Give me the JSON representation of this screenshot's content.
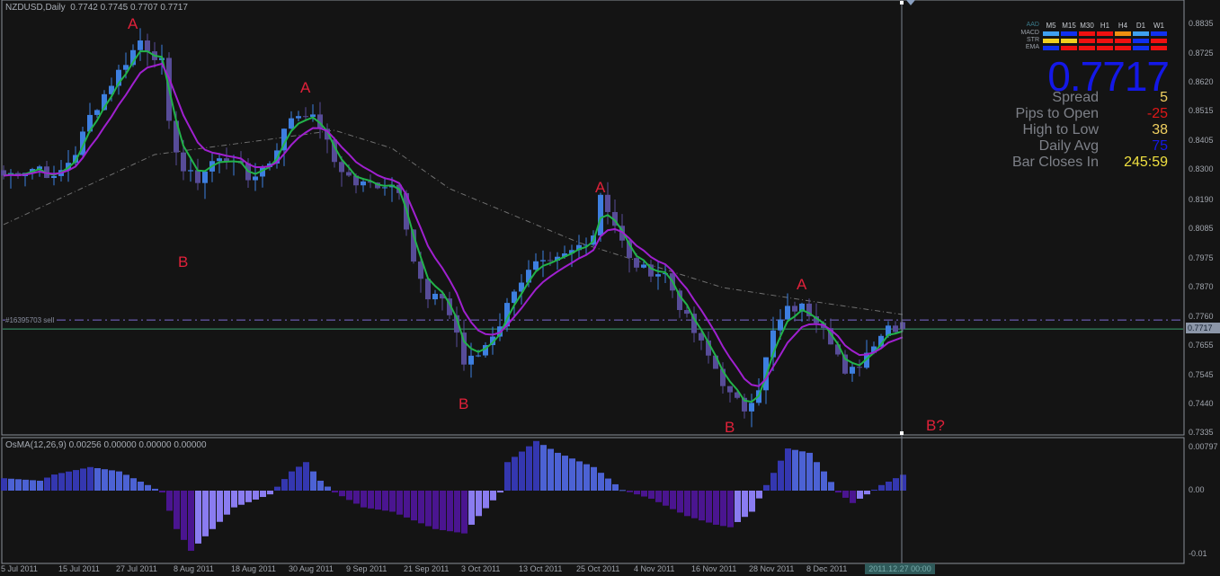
{
  "header": {
    "title": "NZDUSD,Daily",
    "ohlc": "0.7742 0.7745 0.7707 0.7717"
  },
  "order_label": "#16395703 sell",
  "osma_title": "OsMA(12,26,9) 0.00256 0.00000 0.00000 0.00000",
  "dashboard": {
    "brand": "AAD",
    "timeframes": [
      "M5",
      "M15",
      "M30",
      "H1",
      "H4",
      "D1",
      "W1"
    ],
    "rows": [
      {
        "label": "MACD",
        "colors": [
          "#3fa0f0",
          "#1030f0",
          "#f01010",
          "#f01010",
          "#f09010",
          "#3fa0f0",
          "#1030f0"
        ]
      },
      {
        "label": "STR",
        "colors": [
          "#f0d020",
          "#f0d020",
          "#f01010",
          "#f01010",
          "#f01010",
          "#1030f0",
          "#f01010"
        ]
      },
      {
        "label": "EMA",
        "colors": [
          "#1030f0",
          "#f01010",
          "#f01010",
          "#f01010",
          "#f01010",
          "#1030f0",
          "#f01010"
        ]
      }
    ],
    "price": "0.7717",
    "stats": [
      {
        "label": "Spread",
        "value": "5",
        "color": "#f0d060"
      },
      {
        "label": "Pips to Open",
        "value": "-25",
        "color": "#e01818"
      },
      {
        "label": "High to Low",
        "value": "38",
        "color": "#f0d060"
      },
      {
        "label": "Daily Avg",
        "value": "75",
        "color": "#1418e8"
      },
      {
        "label": "Bar Closes In",
        "value": "245:59",
        "color": "#f0e040"
      }
    ]
  },
  "current_price_label": "0.7717",
  "current_time_label": "2011.12.27 00:00",
  "colors": {
    "bull": "#3d7fe0",
    "bear": "#574c98",
    "fast_ma": "#22b34a",
    "slow_ma": "#a020d0",
    "long_ma": "#707070",
    "annotation": "#e0213a",
    "order_line": "#7a6ad0",
    "price_line": "#3aa070"
  },
  "chart_data": [
    {
      "type": "candlestick",
      "title": "NZDUSD,Daily",
      "bars": 126,
      "ylim": [
        0.7335,
        0.8835
      ],
      "yticks": [
        "0.8835",
        "0.8725",
        "0.8620",
        "0.8515",
        "0.8405",
        "0.8300",
        "0.8190",
        "0.8085",
        "0.7975",
        "0.7870",
        "0.7760",
        "0.7655",
        "0.7545",
        "0.7440",
        "0.7335"
      ],
      "xticks": [
        {
          "bar": 0,
          "label": "5 Jul 2011"
        },
        {
          "bar": 8,
          "label": "15 Jul 2011"
        },
        {
          "bar": 16,
          "label": "27 Jul 2011"
        },
        {
          "bar": 24,
          "label": "8 Aug 2011"
        },
        {
          "bar": 32,
          "label": "18 Aug 2011"
        },
        {
          "bar": 40,
          "label": "30 Aug 2011"
        },
        {
          "bar": 48,
          "label": "9 Sep 2011"
        },
        {
          "bar": 56,
          "label": "21 Sep 2011"
        },
        {
          "bar": 64,
          "label": "3 Oct 2011"
        },
        {
          "bar": 72,
          "label": "13 Oct 2011"
        },
        {
          "bar": 80,
          "label": "25 Oct 2011"
        },
        {
          "bar": 88,
          "label": "4 Nov 2011"
        },
        {
          "bar": 96,
          "label": "16 Nov 2011"
        },
        {
          "bar": 104,
          "label": "28 Nov 2011"
        },
        {
          "bar": 112,
          "label": "8 Dec 2011"
        }
      ],
      "close_keypoints": [
        [
          0,
          0.828
        ],
        [
          5,
          0.8313
        ],
        [
          7,
          0.8263
        ],
        [
          10,
          0.8364
        ],
        [
          12,
          0.8496
        ],
        [
          16,
          0.8661
        ],
        [
          19,
          0.8776
        ],
        [
          22,
          0.8694
        ],
        [
          23,
          0.8462
        ],
        [
          25,
          0.8298
        ],
        [
          27,
          0.8265
        ],
        [
          29,
          0.8331
        ],
        [
          32,
          0.8347
        ],
        [
          34,
          0.8265
        ],
        [
          37,
          0.8331
        ],
        [
          40,
          0.8496
        ],
        [
          42,
          0.8512
        ],
        [
          44,
          0.8462
        ],
        [
          46,
          0.8331
        ],
        [
          49,
          0.8248
        ],
        [
          54,
          0.8248
        ],
        [
          55,
          0.8232
        ],
        [
          57,
          0.7968
        ],
        [
          59,
          0.782
        ],
        [
          61,
          0.7836
        ],
        [
          63,
          0.7704
        ],
        [
          64,
          0.7589
        ],
        [
          66,
          0.7622
        ],
        [
          69,
          0.7737
        ],
        [
          71,
          0.7869
        ],
        [
          74,
          0.7951
        ],
        [
          76,
          0.7951
        ],
        [
          79,
          0.8001
        ],
        [
          82,
          0.8067
        ],
        [
          83,
          0.8215
        ],
        [
          85,
          0.81
        ],
        [
          87,
          0.7968
        ],
        [
          89,
          0.7935
        ],
        [
          92,
          0.7918
        ],
        [
          94,
          0.7803
        ],
        [
          96,
          0.7704
        ],
        [
          99,
          0.7572
        ],
        [
          101,
          0.7473
        ],
        [
          103,
          0.7424
        ],
        [
          105,
          0.7506
        ],
        [
          107,
          0.7704
        ],
        [
          109,
          0.7787
        ],
        [
          111,
          0.7797
        ],
        [
          114,
          0.7737
        ],
        [
          116,
          0.7622
        ],
        [
          117,
          0.754
        ],
        [
          119,
          0.7589
        ],
        [
          121,
          0.7671
        ],
        [
          123,
          0.773
        ],
        [
          125,
          0.7717
        ]
      ],
      "last_bar": {
        "open": 0.7742,
        "high": 0.7745,
        "low": 0.7707,
        "close": 0.7717
      },
      "long_ma_keypoints": [
        [
          0,
          0.81
        ],
        [
          21,
          0.8357
        ],
        [
          37,
          0.8413
        ],
        [
          46,
          0.8446
        ],
        [
          54,
          0.838
        ],
        [
          62,
          0.8232
        ],
        [
          80,
          0.8034
        ],
        [
          100,
          0.7869
        ],
        [
          112,
          0.782
        ],
        [
          125,
          0.777
        ]
      ],
      "horizontal_lines": [
        {
          "label": "#16395703 sell",
          "price": 0.775,
          "style": "dash-dot"
        },
        {
          "price": 0.7717,
          "style": "solid"
        }
      ],
      "annotations": [
        {
          "text": "A",
          "bar": 18,
          "price": 0.8835
        },
        {
          "text": "B",
          "bar": 25,
          "price": 0.796
        },
        {
          "text": "A",
          "bar": 42,
          "price": 0.86
        },
        {
          "text": "B",
          "bar": 64,
          "price": 0.744
        },
        {
          "text": "A",
          "bar": 83,
          "price": 0.8235
        },
        {
          "text": "A",
          "bar": 111,
          "price": 0.788
        },
        {
          "text": "B",
          "bar": 101,
          "price": 0.7355
        },
        {
          "text": "B?",
          "bar": 129,
          "price": 0.736
        }
      ]
    },
    {
      "type": "bar",
      "title": "OsMA(12,26,9)",
      "ylim": [
        -0.01,
        0.00797
      ],
      "yticks": [
        "0.00797",
        "0.00",
        "-0.01"
      ],
      "value_keypoints": [
        [
          0,
          0.002
        ],
        [
          5,
          0.0016
        ],
        [
          7,
          0.0026
        ],
        [
          12,
          0.0038
        ],
        [
          16,
          0.0031
        ],
        [
          20,
          0.0009
        ],
        [
          22,
          -0.0003
        ],
        [
          24,
          -0.0062
        ],
        [
          26,
          -0.0097
        ],
        [
          29,
          -0.0062
        ],
        [
          32,
          -0.0027
        ],
        [
          37,
          -0.0006
        ],
        [
          40,
          0.0031
        ],
        [
          42,
          0.0046
        ],
        [
          44,
          0.0016
        ],
        [
          46,
          -0.0003
        ],
        [
          50,
          -0.0027
        ],
        [
          54,
          -0.0034
        ],
        [
          57,
          -0.0048
        ],
        [
          60,
          -0.0062
        ],
        [
          64,
          -0.0069
        ],
        [
          66,
          -0.0041
        ],
        [
          69,
          -0.0003
        ],
        [
          70,
          0.0046
        ],
        [
          74,
          0.008
        ],
        [
          77,
          0.0061
        ],
        [
          82,
          0.0038
        ],
        [
          86,
          0.0001
        ],
        [
          90,
          -0.0013
        ],
        [
          95,
          -0.0041
        ],
        [
          99,
          -0.0055
        ],
        [
          101,
          -0.0059
        ],
        [
          104,
          -0.0034
        ],
        [
          106,
          0.0009
        ],
        [
          109,
          0.0068
        ],
        [
          112,
          0.0061
        ],
        [
          114,
          0.0031
        ],
        [
          116,
          -0.0003
        ],
        [
          118,
          -0.002
        ],
        [
          120,
          -0.0006
        ],
        [
          122,
          0.0009
        ],
        [
          125,
          0.00256
        ]
      ]
    }
  ]
}
